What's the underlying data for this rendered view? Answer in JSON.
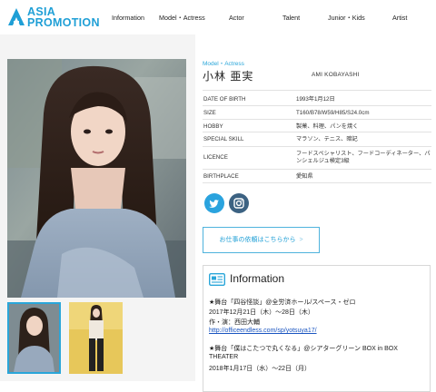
{
  "header": {
    "logo_line1": "ASIA",
    "logo_line2": "PROMOTION",
    "nav": [
      "Information",
      "Model・Actress",
      "Actor",
      "Talent",
      "Junior・Kids",
      "Artist"
    ]
  },
  "profile": {
    "category": "Model・Actress",
    "name_jp": "小林 亜実",
    "name_en": "AMI KOBAYASHI",
    "rows": [
      {
        "key": "DATE OF BIRTH",
        "value": "1993年1月12日"
      },
      {
        "key": "SIZE",
        "value": "T160/B78/W59/H85/S24.0cm"
      },
      {
        "key": "HOBBY",
        "value": "製菓、料理、パンを焼く"
      },
      {
        "key": "SPECIAL SKILL",
        "value": "マラソン、テニス、暗記"
      },
      {
        "key": "LICENCE",
        "value": "フードスペシャリスト、フードコーディネーター、パンシェルジュ検定3級"
      },
      {
        "key": "BIRTHPLACE",
        "value": "愛知県"
      }
    ]
  },
  "social": {
    "twitter_icon": "twitter-bird-icon",
    "instagram_icon": "instagram-icon"
  },
  "work_button": {
    "label": "お仕事の依頼はこちらから",
    "arrow": ">"
  },
  "info": {
    "title": "Information",
    "lines": [
      "★舞台「四谷怪談」@全労済ホール/スペース・ゼロ",
      "2017年12月21日（木）〜28日（木）",
      "作・演：西田大輔",
      "http://officeendless.com/sp/yotsuya17/",
      "★舞台「僕はこたつで丸くなる」@シアターグリーン BOX in BOX",
      "THEATER",
      "2018年1月17日（水）〜22日（月）"
    ]
  },
  "colors": {
    "brand": "#1f9fd6",
    "twitter": "#2aa3de",
    "instagram": "#3c6282"
  }
}
